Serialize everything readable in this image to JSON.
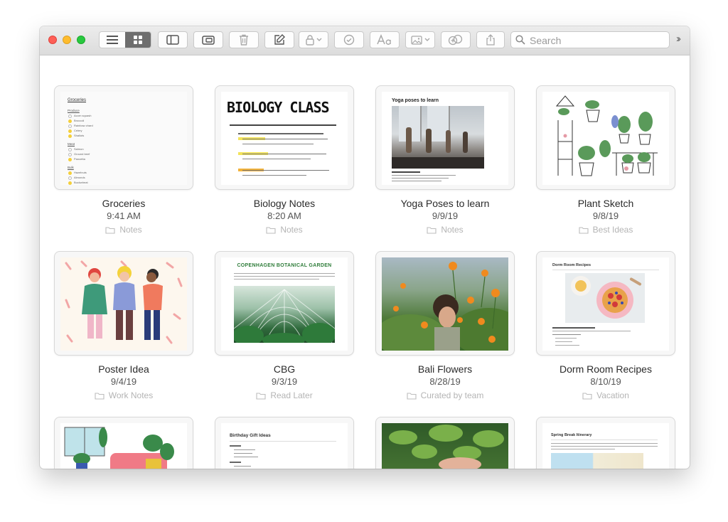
{
  "search": {
    "placeholder": "Search"
  },
  "notes": [
    {
      "title": "Groceries",
      "date": "9:41 AM",
      "folder": "Notes",
      "preview_heading": "Groceries",
      "preview_lines": [
        "Produce",
        "Acorn squash",
        "Broccoli",
        "Rainbow chard",
        "Celery",
        "Shallots",
        "Meat",
        "Salmon",
        "Ground beef",
        "Pancetta",
        "Bulk",
        "Hazelnuts",
        "Almonds",
        "Buckwheat"
      ]
    },
    {
      "title": "Biology Notes",
      "date": "8:20 AM",
      "folder": "Notes",
      "preview_heading": "BIOLOGY CLASS"
    },
    {
      "title": "Yoga Poses to learn",
      "date": "9/9/19",
      "folder": "Notes",
      "preview_heading": "Yoga poses to learn"
    },
    {
      "title": "Plant Sketch",
      "date": "9/8/19",
      "folder": "Best Ideas"
    },
    {
      "title": "Poster Idea",
      "date": "9/4/19",
      "folder": "Work Notes"
    },
    {
      "title": "CBG",
      "date": "9/3/19",
      "folder": "Read Later",
      "preview_heading": "COPENHAGEN BOTANICAL GARDEN"
    },
    {
      "title": "Bali Flowers",
      "date": "8/28/19",
      "folder": "Curated by team"
    },
    {
      "title": "Dorm Room Recipes",
      "date": "8/10/19",
      "folder": "Vacation",
      "preview_heading": "Dorm Room Recipes"
    },
    {
      "preview_heading": ""
    },
    {
      "preview_heading": "Birthday Gift Ideas"
    },
    {
      "preview_heading": ""
    },
    {
      "preview_heading": "Spring Break Itinerary"
    }
  ],
  "colors": {
    "close": "#fe5f57",
    "minimize": "#febc2e",
    "zoom": "#28c840",
    "highlight": "#f4cf3a",
    "accent_green": "#2f7d3a"
  }
}
